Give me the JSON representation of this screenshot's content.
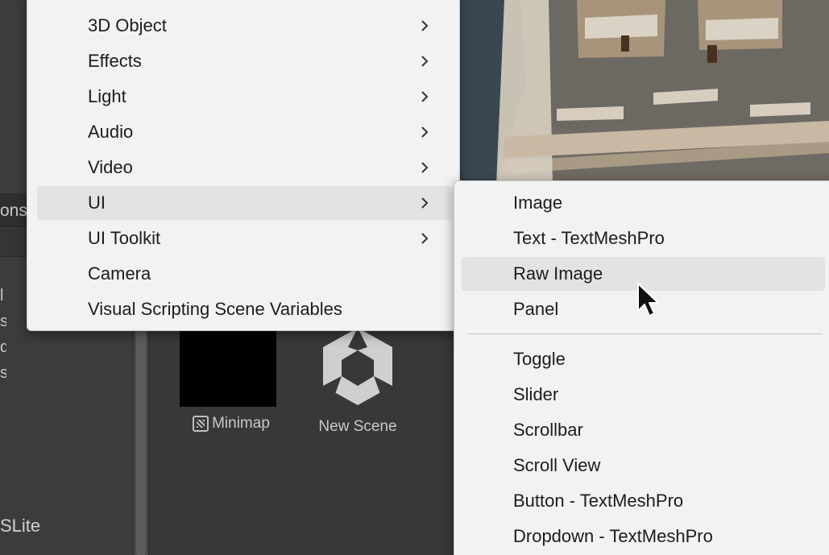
{
  "left_panel": {
    "tab_label": "ons",
    "clipped_letters": [
      "l",
      "s",
      "d",
      "s"
    ],
    "bottom_label": "SLite"
  },
  "assets": [
    {
      "label": "Minimap",
      "icon": "render-texture-icon"
    },
    {
      "label": "New Scene",
      "icon": "unity-scene-icon"
    }
  ],
  "main_menu": {
    "items": [
      {
        "label": "3D Object",
        "submenu": true
      },
      {
        "label": "Effects",
        "submenu": true
      },
      {
        "label": "Light",
        "submenu": true
      },
      {
        "label": "Audio",
        "submenu": true
      },
      {
        "label": "Video",
        "submenu": true
      },
      {
        "label": "UI",
        "submenu": true,
        "highlighted": true
      },
      {
        "label": "UI Toolkit",
        "submenu": true
      },
      {
        "label": "Camera",
        "submenu": false
      },
      {
        "label": "Visual Scripting Scene Variables",
        "submenu": false
      }
    ]
  },
  "ui_submenu": {
    "group1": [
      {
        "label": "Image"
      },
      {
        "label": "Text - TextMeshPro"
      },
      {
        "label": "Raw Image",
        "highlighted": true
      },
      {
        "label": "Panel"
      }
    ],
    "group2": [
      {
        "label": "Toggle"
      },
      {
        "label": "Slider"
      },
      {
        "label": "Scrollbar"
      },
      {
        "label": "Scroll View"
      },
      {
        "label": "Button - TextMeshPro"
      },
      {
        "label": "Dropdown - TextMeshPro"
      }
    ]
  },
  "colors": {
    "menu_bg": "#f2f2f2",
    "menu_highlight": "#e3e3e3",
    "editor_bg": "#383838"
  }
}
